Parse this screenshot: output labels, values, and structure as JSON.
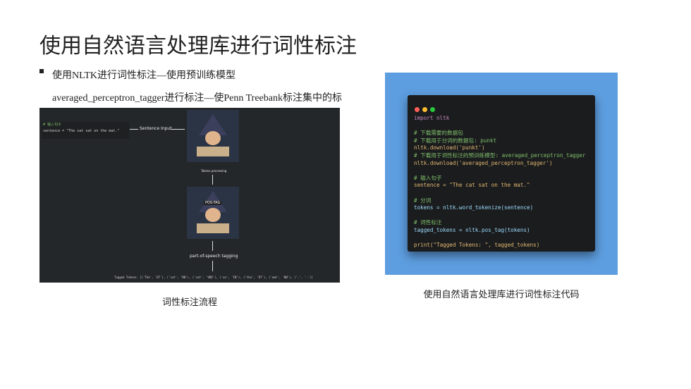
{
  "slide": {
    "title": "使用自然语言处理库进行词性标注",
    "bullet": "使用NLTK进行词性标注—使用预训练模型averaged_perceptron_tagger进行标注—使Penn Treebank标注集中的标签来标注每个单词",
    "caption_left": "词性标注流程",
    "caption_right": "使用自然语言处理库进行词性标注代码"
  },
  "left_figure": {
    "snippet_comment": "# 输入句子",
    "snippet_code": "sentence = \"The cat sat on the mat.\"",
    "label_sentence_input": "Sentence Input",
    "label_tokenize": "Tokens processing",
    "label_pos": "part-of-speech tagging",
    "badge": "POS-TAG",
    "tagged_output": "Tagged Tokens: [('The', 'DT'), ('cat', 'NN'), ('sat', 'VBD'), ('on', 'IN'), ('the', 'DT'), ('mat', 'NN'), ('.', '.')]"
  },
  "code_window": {
    "dot_colors": [
      "#ff5f56",
      "#ffbd2e",
      "#27c93f"
    ],
    "lines": [
      "import nltk",
      "",
      "# 下载需要的数据包",
      "# 下载用于分词的数据包: punkt",
      "nltk.download('punkt')",
      "# 下载用于词性标注的预训练模型: averaged_perceptron_tagger",
      "nltk.download('averaged_perceptron_tagger')",
      "",
      "# 输入句子",
      "sentence = \"The cat sat on the mat.\"",
      "",
      "# 分词",
      "tokens = nltk.word_tokenize(sentence)",
      "",
      "# 词性标注",
      "tagged_tokens = nltk.pos_tag(tokens)",
      "",
      "print(\"Tagged Tokens: \", tagged_tokens)"
    ]
  }
}
